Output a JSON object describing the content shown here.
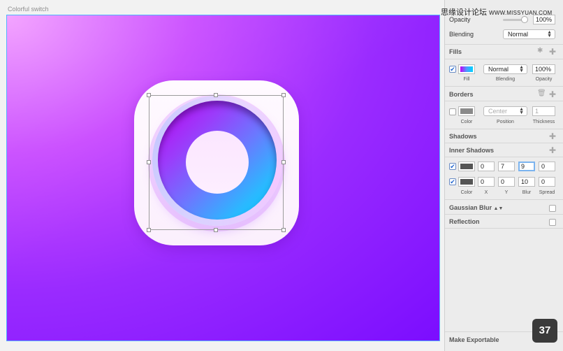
{
  "artboard": {
    "title": "Colorful switch"
  },
  "inspector": {
    "opacity": {
      "label": "Opacity",
      "value": "100%"
    },
    "blending": {
      "label": "Blending",
      "value": "Normal"
    },
    "fills": {
      "title": "Fills",
      "mode": "Normal",
      "opacity": "100%",
      "captions": {
        "fill": "Fill",
        "blending": "Blending",
        "opacity": "Opacity"
      }
    },
    "borders": {
      "title": "Borders",
      "position": "Center",
      "thickness": "1",
      "captions": {
        "color": "Color",
        "position": "Position",
        "thickness": "Thickness"
      }
    },
    "shadows": {
      "title": "Shadows"
    },
    "inner_shadows": {
      "title": "Inner Shadows",
      "rows": [
        {
          "x": "0",
          "y": "7",
          "blur": "9",
          "spread": "0"
        },
        {
          "x": "0",
          "y": "0",
          "blur": "10",
          "spread": "0"
        }
      ],
      "captions": {
        "color": "Color",
        "x": "X",
        "y": "Y",
        "blur": "Blur",
        "spread": "Spread"
      }
    },
    "gaussian_blur": {
      "title": "Gaussian Blur"
    },
    "reflection": {
      "title": "Reflection"
    },
    "make_exportable": {
      "title": "Make Exportable"
    }
  },
  "overlay": {
    "watermark_cn": "思缘设计论坛",
    "watermark_url": "WWW.MISSYUAN.COM",
    "page_number": "37"
  },
  "colors": {
    "fill_swatch_gradient": [
      "#c400f5",
      "#4f9bff",
      "#00d3ff"
    ],
    "border_swatch": "#8a8a8a",
    "inner_shadow_swatch": "#555555",
    "selection_border": "#4fb3ff"
  }
}
